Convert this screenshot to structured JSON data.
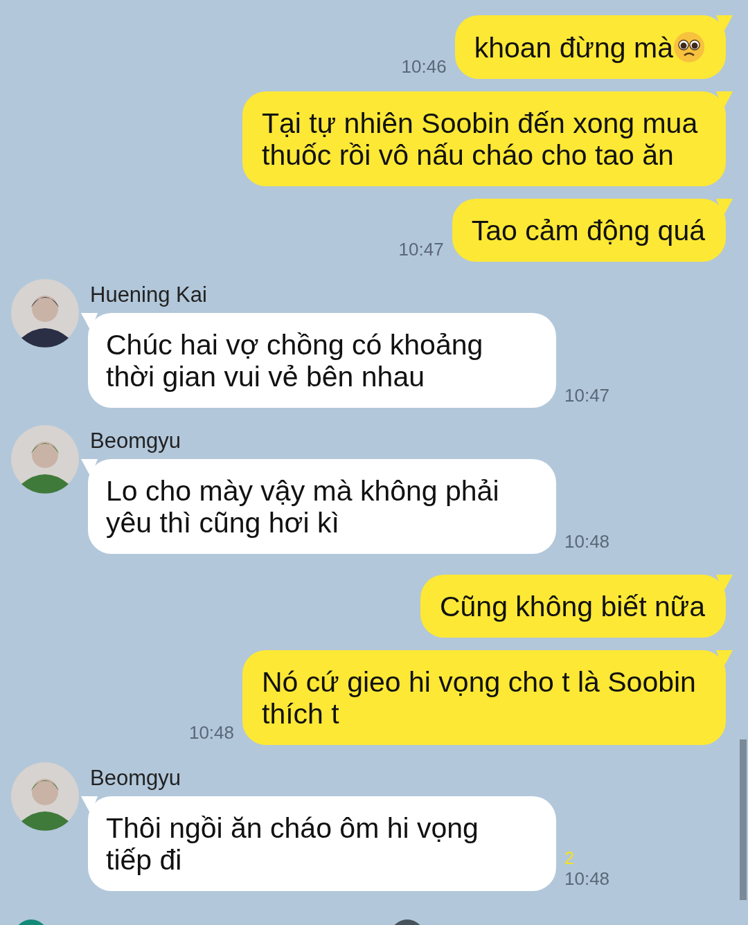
{
  "messages": [
    {
      "kind": "outgoing",
      "text": "khoan đừng mà",
      "emoji": true,
      "time": "10:46"
    },
    {
      "kind": "outgoing",
      "text": "Tại tự nhiên Soobin đến xong mua thuốc rồi vô nấu cháo cho tao ăn"
    },
    {
      "kind": "outgoing",
      "text": "Tao cảm động quá",
      "time": "10:47"
    },
    {
      "kind": "incoming",
      "sender": "Huening Kai",
      "color": "#2a2f45",
      "text": "Chúc hai vợ chồng có khoảng thời gian vui vẻ bên nhau",
      "time": "10:47"
    },
    {
      "kind": "incoming",
      "sender": "Beomgyu",
      "color": "#3f7a3a",
      "text": "Lo cho mày vậy mà không phải yêu thì cũng hơi kì",
      "time": "10:48"
    },
    {
      "kind": "outgoing",
      "text": "Cũng không biết nữa"
    },
    {
      "kind": "outgoing",
      "text": "Nó cứ gieo hi vọng cho t là Soobin thích t",
      "time": "10:48"
    },
    {
      "kind": "incoming",
      "sender": "Beomgyu",
      "color": "#3f7a3a",
      "text": "Thôi ngồi ăn cháo ôm hi vọng tiếp đi",
      "unread": "2",
      "time": "10:48"
    }
  ]
}
